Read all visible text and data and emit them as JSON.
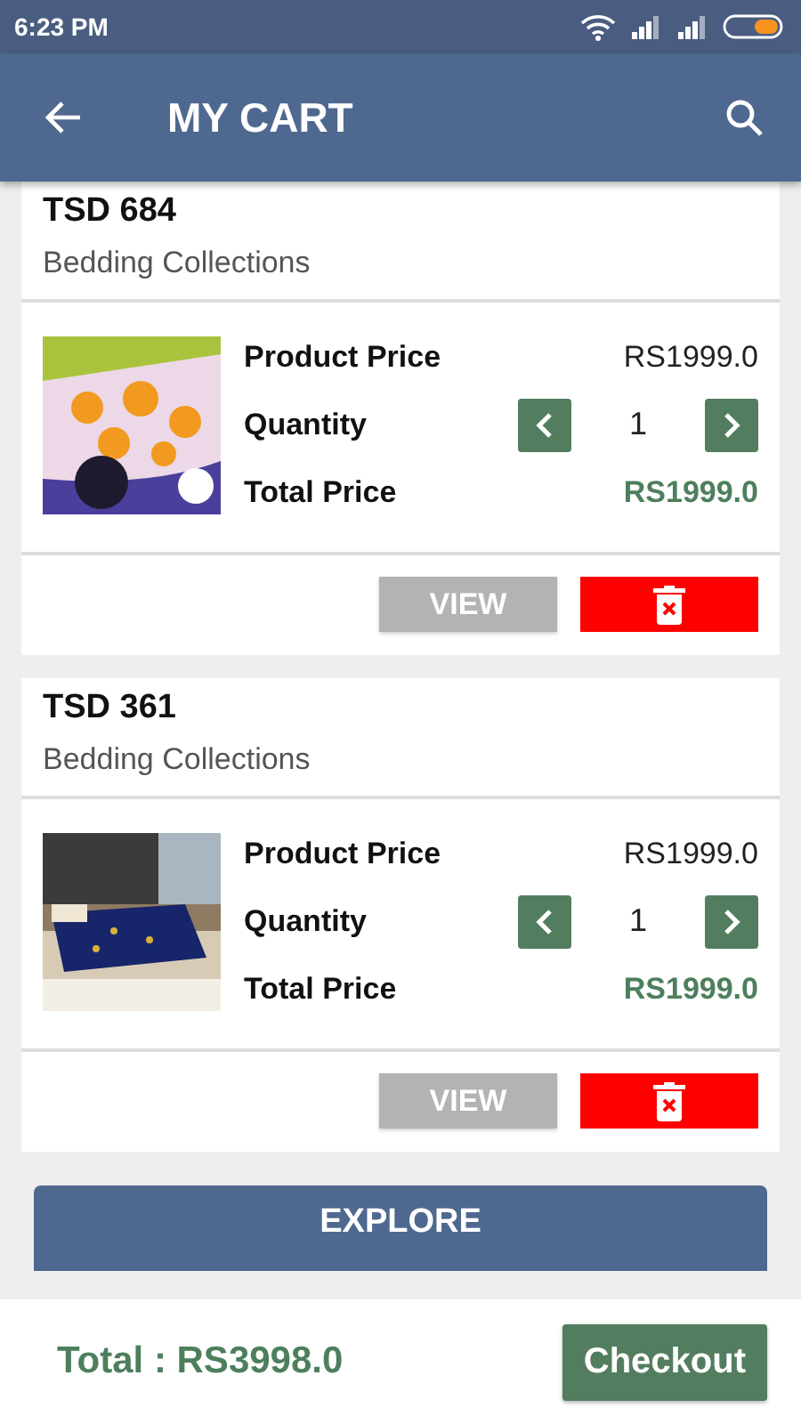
{
  "status_bar": {
    "time": "6:23 PM"
  },
  "app_bar": {
    "title": "MY CART"
  },
  "items": [
    {
      "code": "TSD 684",
      "category": "Bedding Collections",
      "price_label": "Product Price",
      "price": "RS1999.0",
      "quantity_label": "Quantity",
      "quantity": "1",
      "total_label": "Total Price",
      "total": "RS1999.0",
      "view": "VIEW"
    },
    {
      "code": "TSD 361",
      "category": "Bedding Collections",
      "price_label": "Product Price",
      "price": "RS1999.0",
      "quantity_label": "Quantity",
      "quantity": "1",
      "total_label": "Total Price",
      "total": "RS1999.0",
      "view": "VIEW"
    }
  ],
  "explore_button": "EXPLORE",
  "footer": {
    "total": "Total : RS3998.0",
    "checkout": "Checkout"
  }
}
